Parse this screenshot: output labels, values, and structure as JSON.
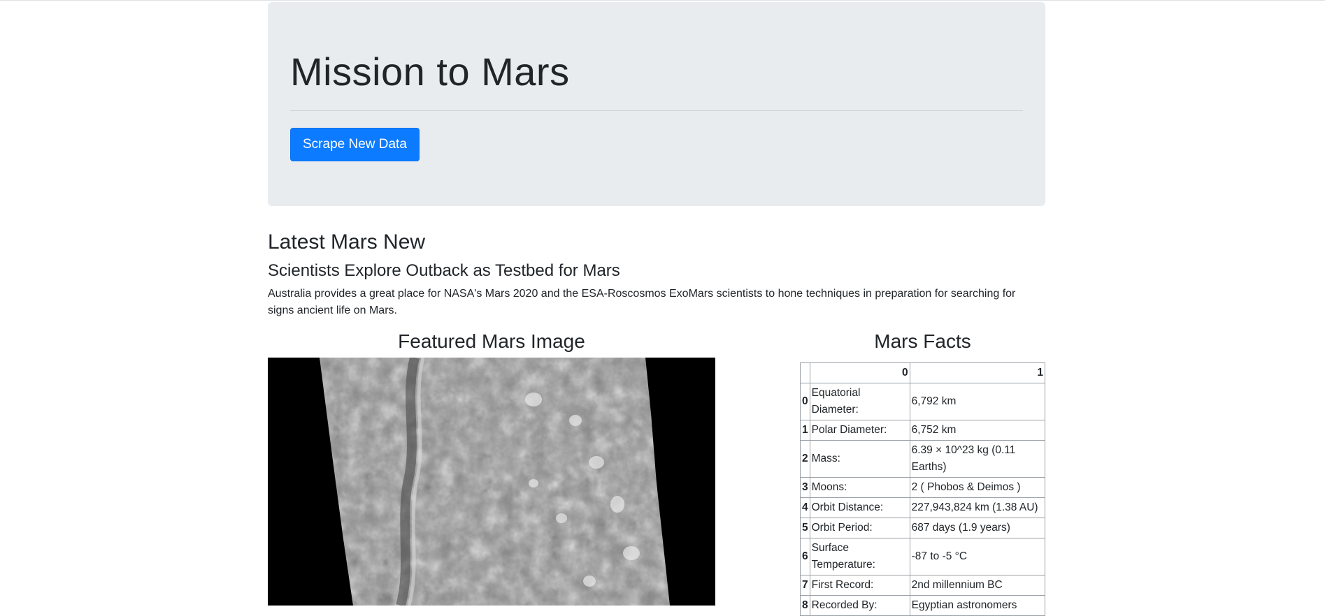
{
  "header": {
    "title": "Mission to Mars",
    "scrape_button": "Scrape New Data"
  },
  "news": {
    "section_heading": "Latest Mars New",
    "title": "Scientists Explore Outback as Testbed for Mars",
    "paragraph": "Australia provides a great place for NASA's Mars 2020 and the ESA-Roscosmos ExoMars scientists to hone techniques in preparation for searching for signs ancient life on Mars."
  },
  "featured": {
    "heading": "Featured Mars Image"
  },
  "facts": {
    "heading": "Mars Facts",
    "columns": [
      "",
      "0",
      "1"
    ],
    "rows": [
      {
        "index": "0",
        "key": "Equatorial Diameter:",
        "value": "6,792 km"
      },
      {
        "index": "1",
        "key": "Polar Diameter:",
        "value": "6,752 km"
      },
      {
        "index": "2",
        "key": "Mass:",
        "value": "6.39 × 10^23 kg (0.11 Earths)"
      },
      {
        "index": "3",
        "key": "Moons:",
        "value": "2 ( Phobos & Deimos )"
      },
      {
        "index": "4",
        "key": "Orbit Distance:",
        "value": "227,943,824 km (1.38 AU)"
      },
      {
        "index": "5",
        "key": "Orbit Period:",
        "value": "687 days (1.9 years)"
      },
      {
        "index": "6",
        "key": "Surface Temperature:",
        "value": "-87 to -5 °C"
      },
      {
        "index": "7",
        "key": "First Record:",
        "value": "2nd millennium BC"
      },
      {
        "index": "8",
        "key": "Recorded By:",
        "value": "Egyptian astronomers"
      }
    ]
  }
}
